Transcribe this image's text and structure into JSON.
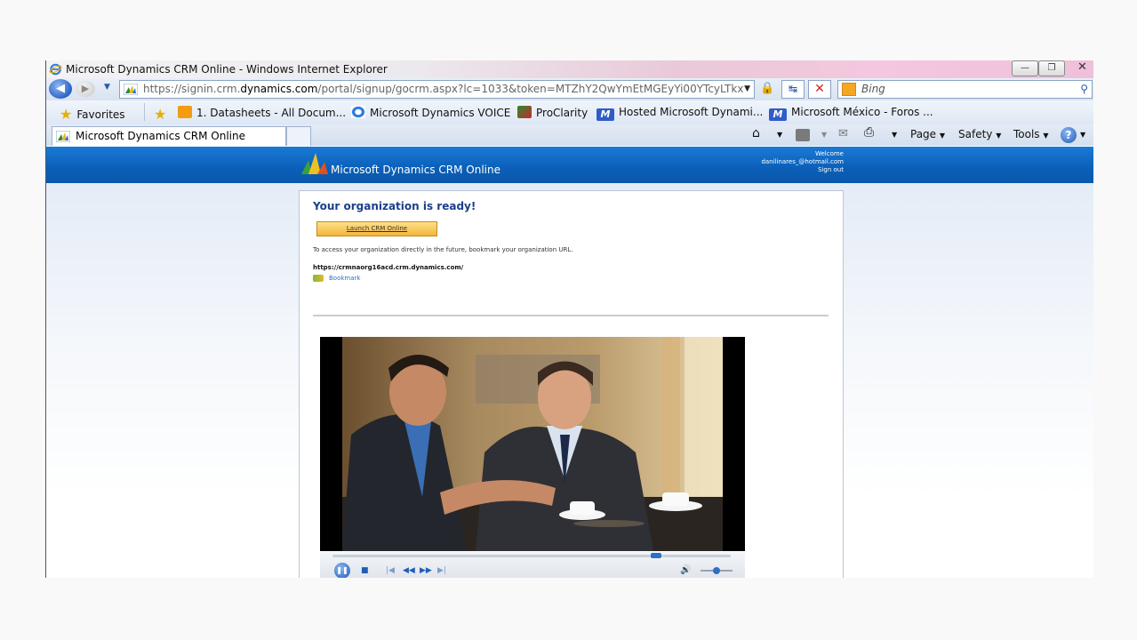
{
  "window": {
    "title": "Microsoft Dynamics CRM Online - Windows Internet Explorer",
    "minimize": "—",
    "restore": "❐",
    "close": "✕"
  },
  "address": {
    "url_scheme": "https://signin.crm.",
    "url_domain": "dynamics.com",
    "url_rest": "/portal/signup/gocrm.aspx?lc=1033&token=MTZhY2QwYmEtMGEyYi00YTcyLTkx",
    "search_placeholder": "Bing"
  },
  "favorites": {
    "label": "Favorites",
    "items": [
      {
        "label": "1. Datasheets - All Docum..."
      },
      {
        "label": "Microsoft Dynamics VOICE"
      },
      {
        "label": "ProClarity"
      },
      {
        "label": "Hosted Microsoft Dynami..."
      },
      {
        "label": "Microsoft México - Foros ..."
      }
    ]
  },
  "tab": {
    "label": "Microsoft Dynamics CRM Online"
  },
  "commandbar": {
    "page": "Page",
    "safety": "Safety",
    "tools": "Tools"
  },
  "crm": {
    "title": "Microsoft Dynamics CRM Online",
    "welcome": "Welcome",
    "user": "danilinares_@hotmail.com",
    "signout": "Sign out",
    "heading": "Your organization is ready!",
    "launch_label": "Launch CRM Online",
    "access_text": "To access your organization directly in the future, bookmark your organization URL.",
    "org_url": "https://crmnaorg16acd.crm.dynamics.com/",
    "bookmark_label": "Bookmark"
  },
  "video": {
    "progress": 0.82,
    "volume": 0.5
  },
  "colors": {
    "header_blue": "#0b5fb8",
    "heading_blue": "#1d3f8c",
    "launch_gold": "#f3b53a"
  }
}
